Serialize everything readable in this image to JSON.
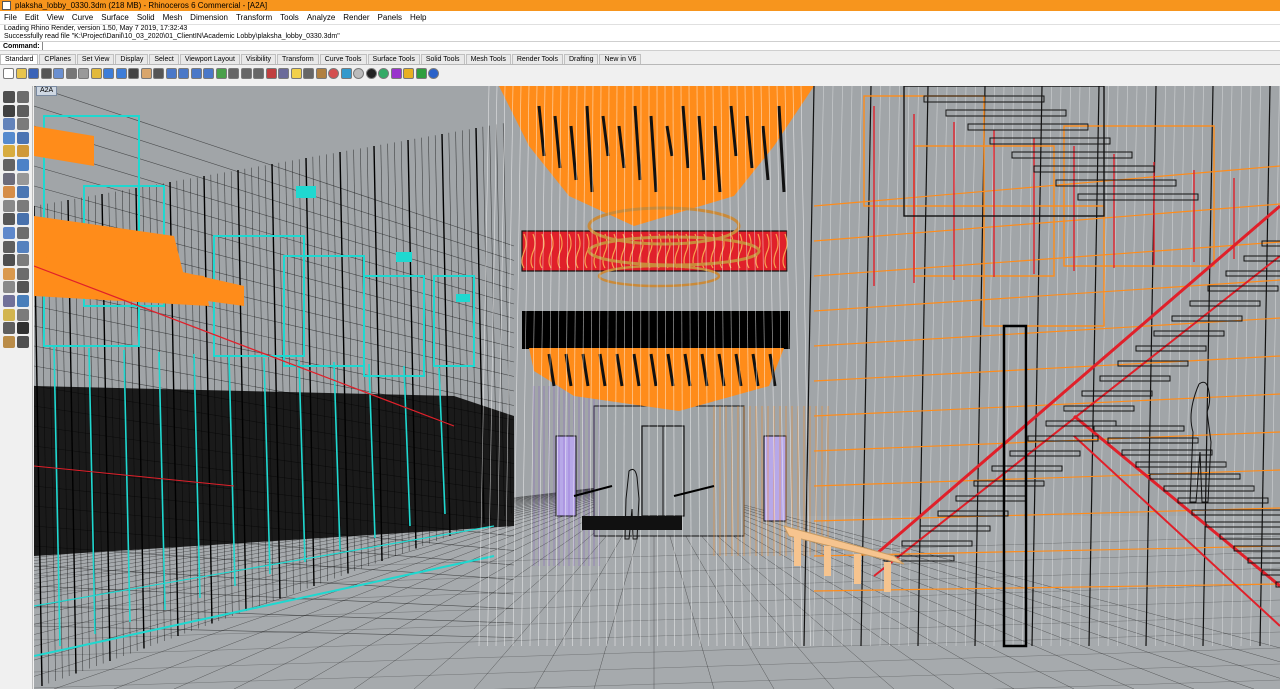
{
  "window": {
    "title": "plaksha_lobby_0330.3dm (218 MB) - Rhinoceros 6 Commercial - [A2A]"
  },
  "menu": {
    "items": [
      "File",
      "Edit",
      "View",
      "Curve",
      "Surface",
      "Solid",
      "Mesh",
      "Dimension",
      "Transform",
      "Tools",
      "Analyze",
      "Render",
      "Panels",
      "Help"
    ]
  },
  "command_history": {
    "lines": [
      "Loading Rhino Render, version 1.50, May  7 2019, 17:32:43",
      "Successfully read file \"K:\\Project\\Danil\\10_03_2020\\01_ClientIN\\Academic Lobby\\plaksha_lobby_0330.3dm\""
    ]
  },
  "command_line": {
    "label": "Command:",
    "value": ""
  },
  "tabs": {
    "items": [
      "Standard",
      "CPlanes",
      "Set View",
      "Display",
      "Select",
      "Viewport Layout",
      "Visibility",
      "Transform",
      "Curve Tools",
      "Surface Tools",
      "Solid Tools",
      "Mesh Tools",
      "Render Tools",
      "Drafting",
      "New in V6"
    ],
    "active": "Standard"
  },
  "toolbar": {
    "icons": [
      "new-file-icon",
      "open-file-icon",
      "save-icon",
      "print-icon",
      "import-icon",
      "cut-icon",
      "copy-icon",
      "paste-icon",
      "undo-icon",
      "redo-icon",
      "pan-icon",
      "hand-icon",
      "move-view-icon",
      "zoom-window-icon",
      "zoom-extents-icon",
      "zoom-selected-icon",
      "zoom-in-icon",
      "rotate-view-icon",
      "four-viewports-icon",
      "viewport-grid-icon",
      "cplane-icon",
      "clipping-icon",
      "layer-icon",
      "lightbulb-icon",
      "properties-icon",
      "lock-icon",
      "color-wheel-icon",
      "render-icon",
      "material-sphere-icon",
      "rendered-sphere-icon",
      "environment-icon",
      "options-icon",
      "sun-icon",
      "grasshopper-icon",
      "help-icon"
    ]
  },
  "viewport": {
    "label": "A2A"
  },
  "colors": {
    "title_bar": "#f7951d",
    "viewport_bg": "#a1a5a8",
    "ceiling_orange": "#ff8c1a",
    "glass_cyan": "#1fd8d0",
    "stair_red": "#e0202a",
    "bench_peach": "#f6c48f",
    "wireframe": "#101010"
  }
}
